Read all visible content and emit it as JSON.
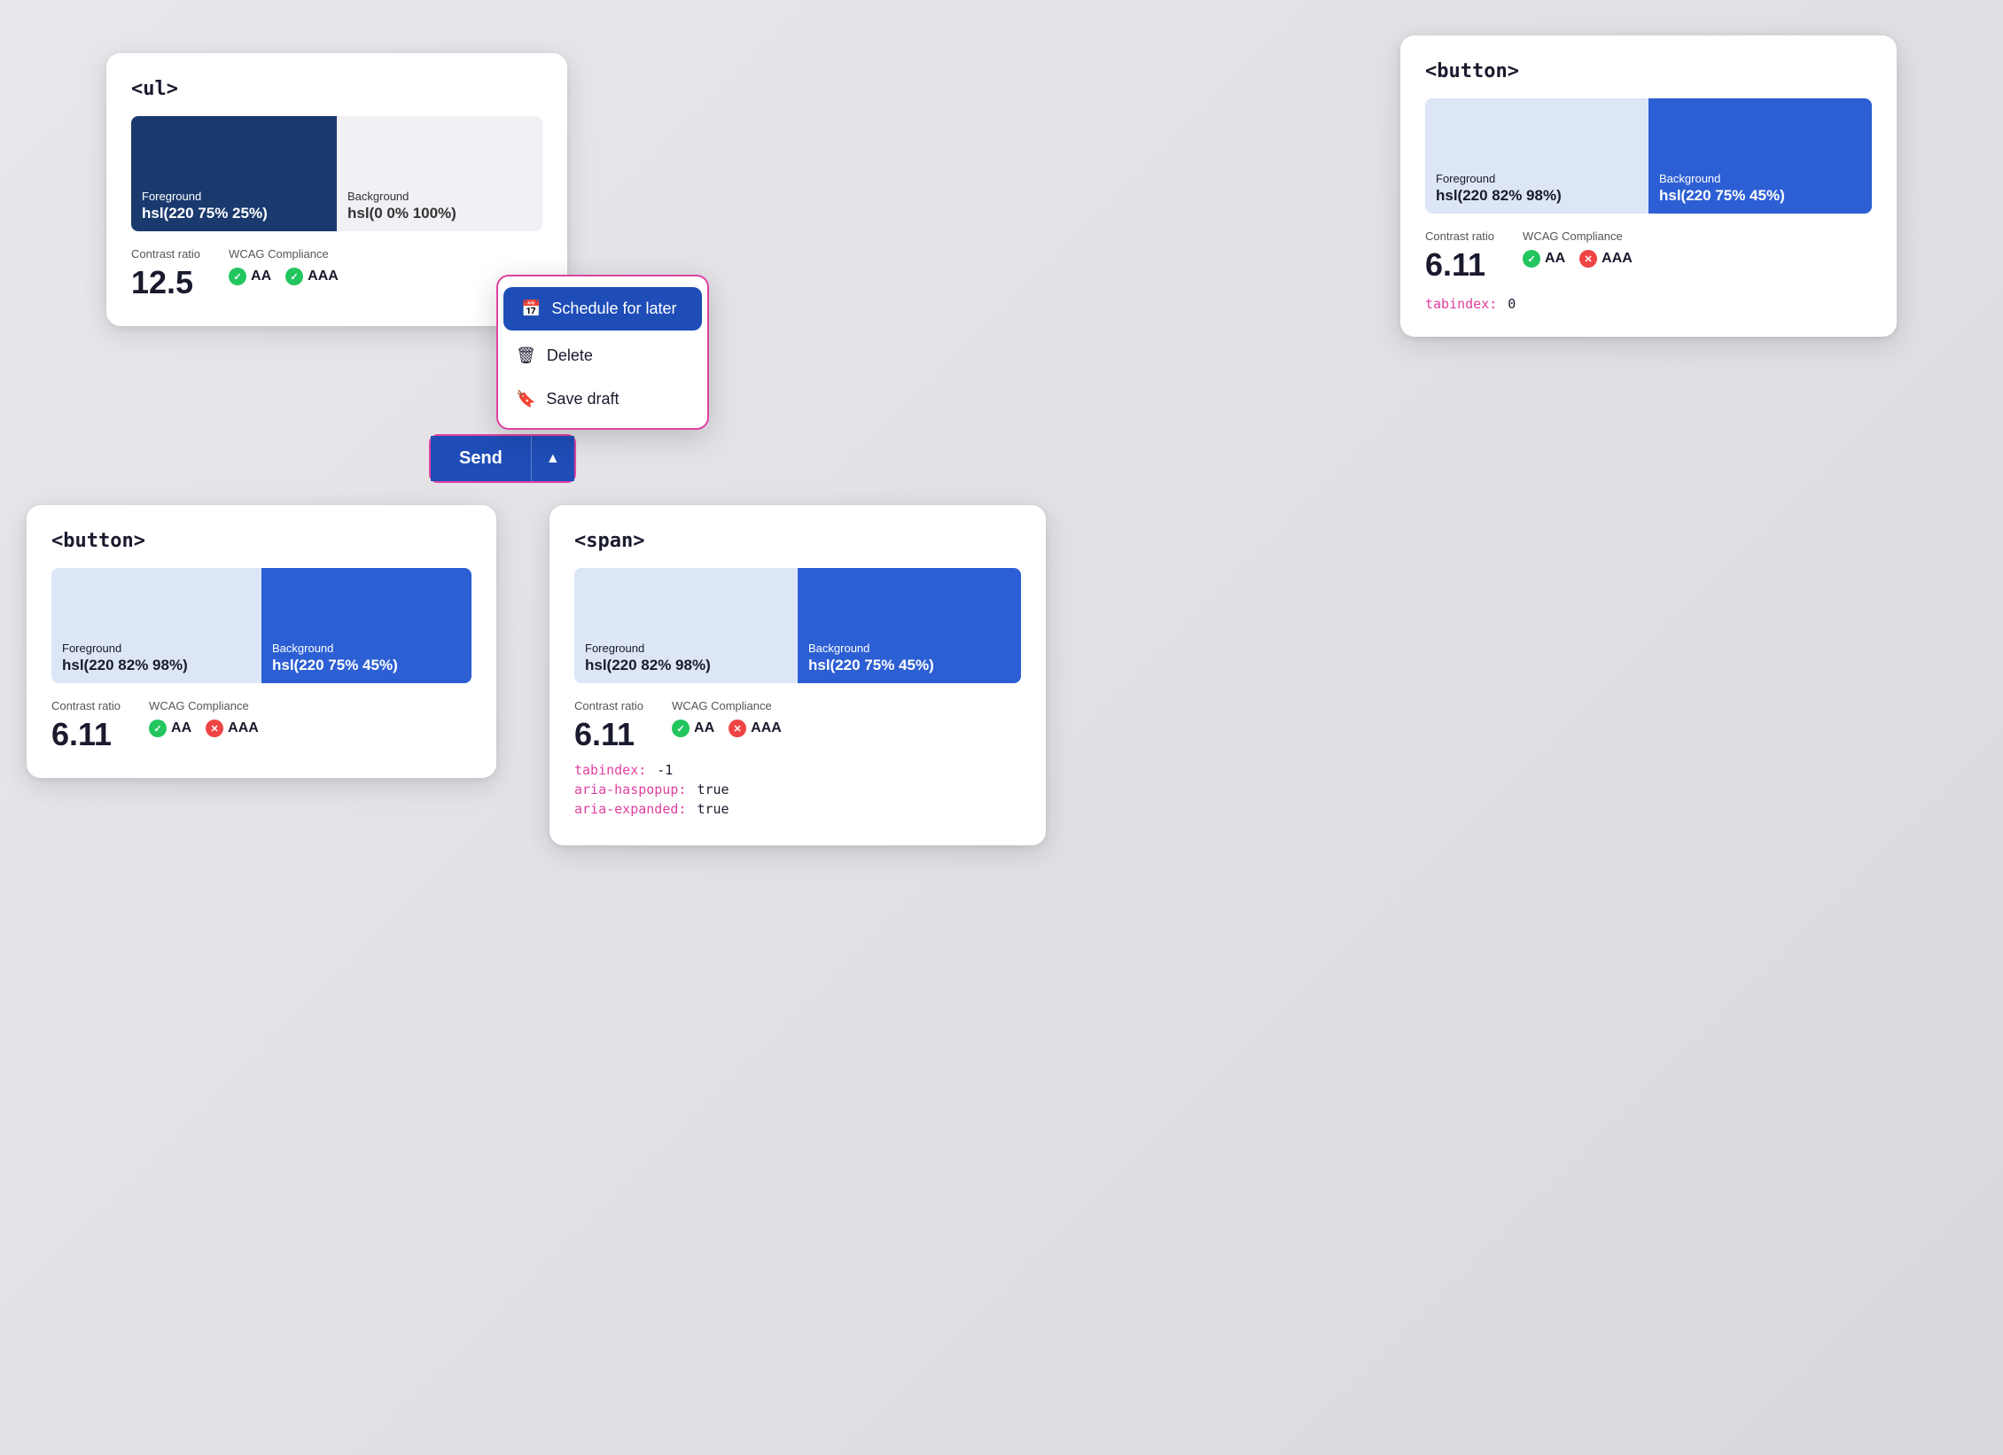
{
  "cards": {
    "top_left": {
      "title": "<ul>",
      "foreground_label": "Foreground",
      "foreground_value": "hsl(220 75% 25%)",
      "background_label": "Background",
      "background_value": "hsl(0 0% 100%)",
      "contrast_label": "Contrast ratio",
      "contrast_value": "12.5",
      "wcag_label": "WCAG Compliance",
      "aa_label": "AA",
      "aaa_label": "AAA",
      "aa_pass": true,
      "aaa_pass": true
    },
    "top_right": {
      "title": "<button>",
      "foreground_label": "Foreground",
      "foreground_value": "hsl(220 82% 98%)",
      "background_label": "Background",
      "background_value": "hsl(220 75% 45%)",
      "contrast_label": "Contrast ratio",
      "contrast_value": "6.11",
      "wcag_label": "WCAG Compliance",
      "aa_label": "AA",
      "aaa_label": "AAA",
      "aa_pass": true,
      "aaa_pass": false,
      "tabindex_label": "tabindex:",
      "tabindex_value": "0"
    },
    "bottom_left": {
      "title": "<button>",
      "foreground_label": "Foreground",
      "foreground_value": "hsl(220 82% 98%)",
      "background_label": "Background",
      "background_value": "hsl(220 75% 45%)",
      "contrast_label": "Contrast ratio",
      "contrast_value": "6.11",
      "wcag_label": "WCAG Compliance",
      "aa_label": "AA",
      "aaa_label": "AAA",
      "aa_pass": true,
      "aaa_pass": false
    },
    "bottom_right": {
      "title": "<span>",
      "foreground_label": "Foreground",
      "foreground_value": "hsl(220 82% 98%)",
      "background_label": "Background",
      "background_value": "hsl(220 75% 45%)",
      "contrast_label": "Contrast ratio",
      "contrast_value": "6.11",
      "wcag_label": "WCAG Compliance",
      "aa_label": "AA",
      "aaa_label": "AAA",
      "aa_pass": true,
      "aaa_pass": false,
      "tabindex_label": "tabindex:",
      "tabindex_value": "-1",
      "aria_haspopup_label": "aria-haspopup:",
      "aria_haspopup_value": "true",
      "aria_expanded_label": "aria-expanded:",
      "aria_expanded_value": "true"
    }
  },
  "dropdown": {
    "items": [
      {
        "label": "Schedule for later",
        "icon": "📅",
        "active": true
      },
      {
        "label": "Delete",
        "icon": "🗑",
        "active": false
      },
      {
        "label": "Save draft",
        "icon": "🔖",
        "active": false
      }
    ]
  },
  "send_button": {
    "label": "Send",
    "chevron": "▲"
  }
}
